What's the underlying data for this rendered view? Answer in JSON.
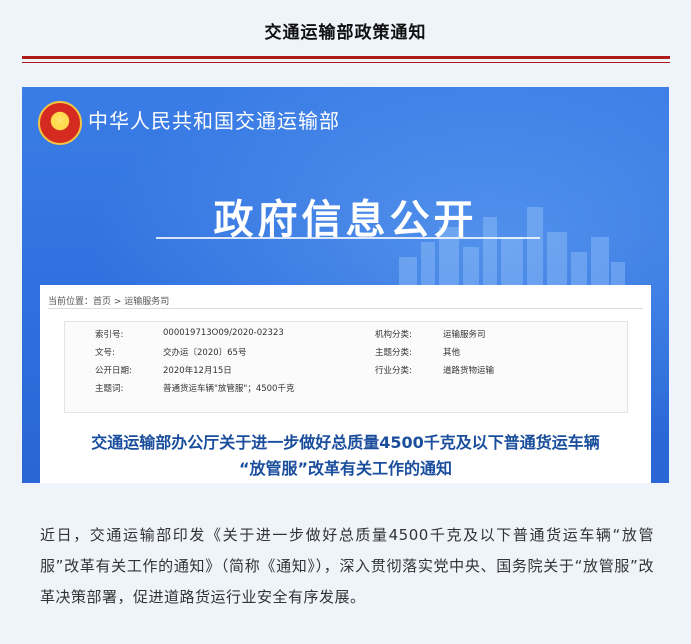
{
  "header": {
    "title": "交通运输部政策通知"
  },
  "banner": {
    "ministry_name": "中华人民共和国交通运输部",
    "section_title": "政府信息公开"
  },
  "breadcrumb": "当前位置：首页 > 运输服务司",
  "info": {
    "index_label": "索引号:",
    "index_value": "000019713O09/2020-02323",
    "org_label": "机构分类:",
    "org_value": "运输服务司",
    "doc_label": "文号:",
    "doc_value": "交办运〔2020〕65号",
    "topic_label": "主题分类:",
    "topic_value": "其他",
    "date_label": "公开日期:",
    "date_value": "2020年12月15日",
    "industry_label": "行业分类:",
    "industry_value": "道路货物运输",
    "keyword_label": "主题词:",
    "keyword_value": "普通货运车辆\"放管服\"；4500千克"
  },
  "doc_title": {
    "line1": "交通运输部办公厅关于进一步做好总质量4500千克及以下普通货运车辆",
    "line2": "“放管服”改革有关工作的通知"
  },
  "body_text": "近日，交通运输部印发《关于进一步做好总质量4500千克及以下普通货运车辆“放管服”改革有关工作的通知》（简称《通知》），深入贯彻落实党中央、国务院关于“放管服”改革决策部署，促进道路货运行业安全有序发展。",
  "colors": {
    "accent_red": "#b01a1a",
    "banner_blue": "#2f6fde",
    "title_blue": "#1a4e9c"
  }
}
